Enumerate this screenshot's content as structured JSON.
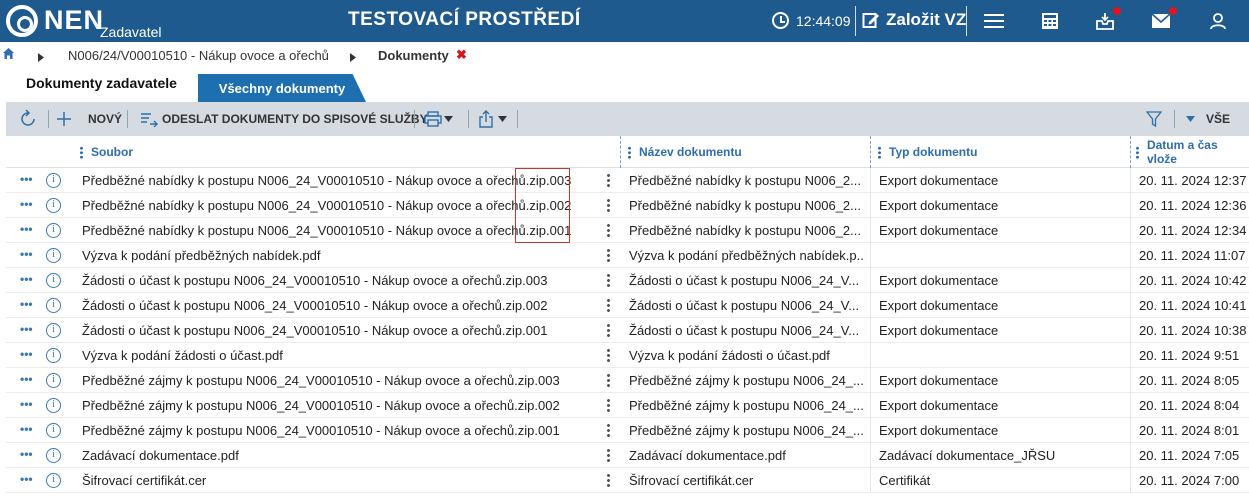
{
  "header": {
    "logo_text": "NEN",
    "logo_sub": "Zadavatel",
    "env_title": "TESTOVACÍ PROSTŘEDÍ",
    "time": "12:44:09",
    "create_label": "Založit VZ",
    "icons": [
      "home-icon",
      "clock-icon",
      "edit-icon",
      "menu-icon",
      "calculator-icon",
      "inbox-icon",
      "mail-icon",
      "user-icon"
    ],
    "accent": "#1e5a8e"
  },
  "breadcrumb": {
    "item1": "N006/24/V00010510 - Nákup ovoce a ořechů",
    "item2": "Dokumenty",
    "close": "✖"
  },
  "tabs": {
    "active": "Dokumenty zadavatele",
    "other": "Všechny dokumenty"
  },
  "toolbar": {
    "new_label": "NOVÝ",
    "send_label": "ODESLAT DOKUMENTY DO SPISOVÉ SLUŽBY",
    "filter_label": "VŠE"
  },
  "table": {
    "columns": [
      "Soubor",
      "Název dokumentu",
      "Typ dokumentu",
      "Datum a čas vlože"
    ],
    "rows": [
      {
        "file": "Předběžné nabídky k postupu N006_24_V00010510 - Nákup ovoce a ořechů.zip.003",
        "name": "Předběžné nabídky k postupu N006_2...",
        "type": "Export dokumentace",
        "date": "20. 11. 2024 12:37"
      },
      {
        "file": "Předběžné nabídky k postupu N006_24_V00010510 - Nákup ovoce a ořechů.zip.002",
        "name": "Předběžné nabídky k postupu N006_2...",
        "type": "Export dokumentace",
        "date": "20. 11. 2024 12:36"
      },
      {
        "file": "Předběžné nabídky k postupu N006_24_V00010510 - Nákup ovoce a ořechů.zip.001",
        "name": "Předběžné nabídky k postupu N006_2...",
        "type": "Export dokumentace",
        "date": "20. 11. 2024 12:34"
      },
      {
        "file": "Výzva k podání předběžných nabídek.pdf",
        "name": "Výzva k podání předběžných nabídek.p...",
        "type": "",
        "date": "20. 11. 2024 11:07"
      },
      {
        "file": "Žádosti o účast k postupu N006_24_V00010510 - Nákup ovoce a ořechů.zip.003",
        "name": "Žádosti o účast k postupu N006_24_V...",
        "type": "Export dokumentace",
        "date": "20. 11. 2024 10:42"
      },
      {
        "file": "Žádosti o účast k postupu N006_24_V00010510 - Nákup ovoce a ořechů.zip.002",
        "name": "Žádosti o účast k postupu N006_24_V...",
        "type": "Export dokumentace",
        "date": "20. 11. 2024 10:41"
      },
      {
        "file": "Žádosti o účast k postupu N006_24_V00010510 - Nákup ovoce a ořechů.zip.001",
        "name": "Žádosti o účast k postupu N006_24_V...",
        "type": "Export dokumentace",
        "date": "20. 11. 2024 10:38"
      },
      {
        "file": "Výzva k podání žádosti o účast.pdf",
        "name": "Výzva k podání žádosti o účast.pdf",
        "type": "",
        "date": "20. 11. 2024 9:51"
      },
      {
        "file": "Předběžné zájmy k postupu N006_24_V00010510 - Nákup ovoce a ořechů.zip.003",
        "name": "Předběžné zájmy k postupu N006_24_...",
        "type": "Export dokumentace",
        "date": "20. 11. 2024 8:05"
      },
      {
        "file": "Předběžné zájmy k postupu N006_24_V00010510 - Nákup ovoce a ořechů.zip.002",
        "name": "Předběžné zájmy k postupu N006_24_...",
        "type": "Export dokumentace",
        "date": "20. 11. 2024 8:04"
      },
      {
        "file": "Předběžné zájmy k postupu N006_24_V00010510 - Nákup ovoce a ořechů.zip.001",
        "name": "Předběžné zájmy k postupu N006_24_...",
        "type": "Export dokumentace",
        "date": "20. 11. 2024 8:01"
      },
      {
        "file": "Zadávací dokumentace.pdf",
        "name": "Zadávací dokumentace.pdf",
        "type": "Zadávací dokumentace_JŘSU",
        "date": "20. 11. 2024 7:05"
      },
      {
        "file": "Šifrovací certifikát.cer",
        "name": "Šifrovací certifikát.cer",
        "type": "Certifikát",
        "date": "20. 11. 2024 7:00"
      }
    ]
  }
}
